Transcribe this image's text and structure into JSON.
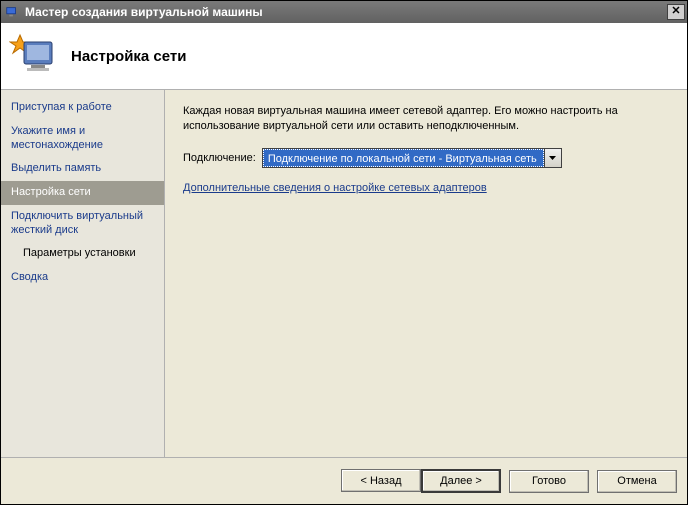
{
  "window": {
    "title": "Мастер создания виртуальной машины"
  },
  "header": {
    "title": "Настройка сети"
  },
  "steps": {
    "s0": "Приступая к работе",
    "s1": "Укажите имя и местонахождение",
    "s2": "Выделить память",
    "s3": "Настройка сети",
    "s4": "Подключить виртуальный жесткий диск",
    "s4a": "Параметры установки",
    "s5": "Сводка"
  },
  "content": {
    "description": "Каждая новая виртуальная машина имеет сетевой адаптер. Его можно настроить на использование виртуальной сети или оставить неподключенным.",
    "connection_label": "Подключение:",
    "connection_value": "Подключение по локальной сети - Виртуальная сеть",
    "more_link": "Дополнительные сведения о настройке сетевых адаптеров"
  },
  "buttons": {
    "back": "< Назад",
    "next": "Далее >",
    "finish": "Готово",
    "cancel": "Отмена"
  }
}
